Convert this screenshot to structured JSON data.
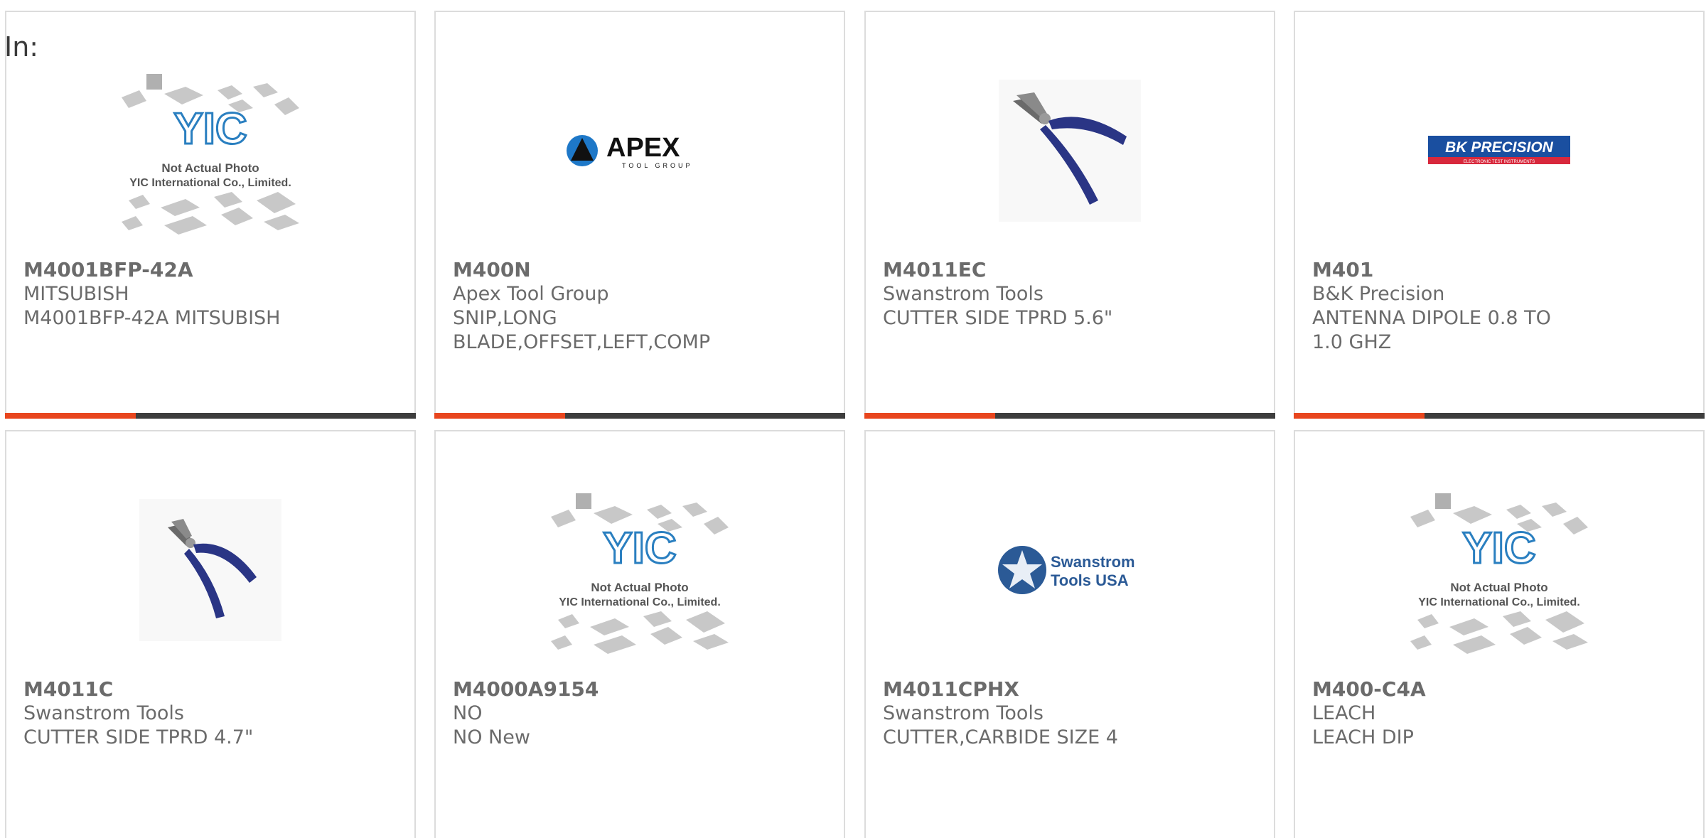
{
  "filter": {
    "label": "In:"
  },
  "placeholder_text": {
    "line1": "Not Actual Photo",
    "line2": "YIC International Co., Limited.",
    "logo": "YIC"
  },
  "logos": {
    "apex": {
      "name": "APEX",
      "sub": "TOOL GROUP"
    },
    "bk": {
      "name": "BK PRECISION",
      "sub": "ELECTRONIC TEST INSTRUMENTS"
    },
    "swanstrom": {
      "line1": "Swanstrom",
      "line2": "Tools USA"
    }
  },
  "colors": {
    "accent": "#e8461e",
    "bar": "#3d3d3d",
    "text": "#6b6b6b",
    "border": "#dcdcdc"
  },
  "products": [
    {
      "part": "M4001BFP-42A",
      "manufacturer": "MITSUBISH",
      "description": "M4001BFP-42A MITSUBISH",
      "image": "yic-placeholder"
    },
    {
      "part": "M400N",
      "manufacturer": "Apex Tool Group",
      "description": "SNIP,LONG BLADE,OFFSET,LEFT,COMP",
      "image": "apex-logo"
    },
    {
      "part": "M4011EC",
      "manufacturer": "Swanstrom Tools",
      "description": "CUTTER SIDE TPRD 5.6\"",
      "image": "pliers-photo"
    },
    {
      "part": "M401",
      "manufacturer": "B&K Precision",
      "description": "ANTENNA DIPOLE 0.8 TO 1.0 GHZ",
      "image": "bk-precision-logo"
    },
    {
      "part": "M4011C",
      "manufacturer": "Swanstrom Tools",
      "description": "CUTTER SIDE TPRD 4.7\"",
      "image": "pliers-photo"
    },
    {
      "part": "M4000A9154",
      "manufacturer": "NO",
      "description": "NO New",
      "image": "yic-placeholder"
    },
    {
      "part": "M4011CPHX",
      "manufacturer": "Swanstrom Tools",
      "description": "CUTTER,CARBIDE SIZE 4",
      "image": "swanstrom-logo"
    },
    {
      "part": "M400-C4A",
      "manufacturer": "LEACH",
      "description": "LEACH DIP",
      "image": "yic-placeholder"
    }
  ]
}
